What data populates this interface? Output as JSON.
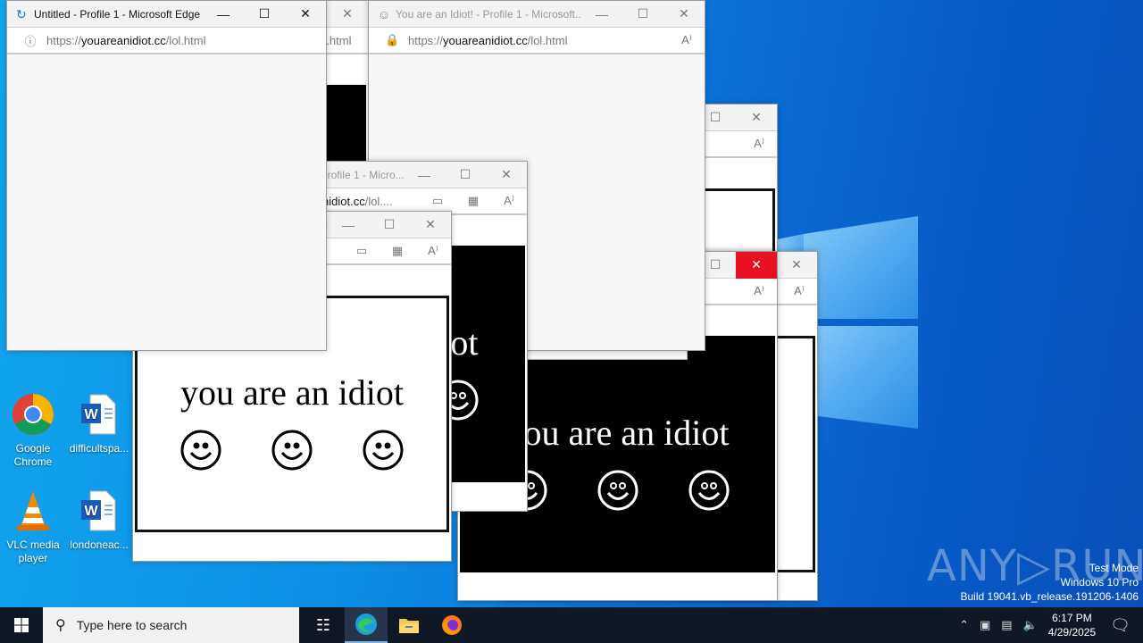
{
  "desktop": {
    "icons": [
      {
        "label": "Google Chrome",
        "icon": "chrome-icon"
      },
      {
        "label": "difficultspa...",
        "icon": "word-document-icon"
      },
      {
        "label": "VLC media player",
        "icon": "vlc-icon"
      },
      {
        "label": "londoneac...",
        "icon": "word-document-icon"
      }
    ]
  },
  "windows": [
    {
      "id": "c",
      "title": "You are an Idiot! - Profile 1 - Microsoft...",
      "url_pre": "https://",
      "url_host": "youareanidiot.cc",
      "url_path": "/lol.html",
      "tools": [
        "read-aloud"
      ],
      "content": "idiot",
      "inverted": false,
      "active": false,
      "red_close": false
    },
    {
      "id": "a",
      "title": "You are an Idiot! - Profile 1 - Microsoft...",
      "url_pre": "https://",
      "url_host": "youareanidiot.cc",
      "url_path": "/lol.html",
      "tools": [
        "read-aloud"
      ],
      "content": "idiot",
      "inverted": false,
      "active": false,
      "red_close": false
    },
    {
      "id": "b",
      "title": "You are an Idiot! - Profile 1 - Microsoft...",
      "url_pre": "https://",
      "url_host": "youareanidiot.cc",
      "url_path": "/lol.html",
      "tools": [
        "read-aloud"
      ],
      "content": "idiot",
      "inverted": true,
      "active": false,
      "red_close": true
    },
    {
      "id": "h",
      "title": "You are an Idiot! - Profile 1 - Microsoft...",
      "url_pre": "https://",
      "url_host": "youareanidiot.cc",
      "url_path": "/lol.html",
      "tools": [],
      "content": "idiot",
      "inverted": true,
      "active": false,
      "red_close": false
    },
    {
      "id": "d",
      "title": "You are an Idiot! - Profile 1 - Microsoft...",
      "url_pre": "https://",
      "url_host": "youareanidiot.cc",
      "url_path": "/lol.html",
      "lock": true,
      "tools": [
        "read-aloud"
      ],
      "content": "blank",
      "active": false,
      "red_close": false
    },
    {
      "id": "e",
      "title": "You are an Idiot! - Profile 1 - Micro...",
      "url_pre": "https://",
      "url_host": "youareanidiot.cc",
      "url_path": "/lol....",
      "tools": [
        "devices",
        "qr-code",
        "read-aloud"
      ],
      "content": "idiot",
      "inverted": true,
      "active": false,
      "red_close": false
    },
    {
      "id": "f",
      "title": "You are an Idiot! - Profile 1 - Micro...",
      "url_pre": "https://",
      "url_host": "youareanidiot.cc",
      "url_path": "/lol....",
      "tools": [
        "devices",
        "qr-code",
        "read-aloud"
      ],
      "content": "idiot",
      "inverted": false,
      "active": false,
      "red_close": false
    },
    {
      "id": "g",
      "title": "Untitled - Profile 1 - Microsoft Edge",
      "url_pre": "https://",
      "url_host": "youareanidiot.cc",
      "url_path": "/lol.html",
      "info": true,
      "loading": true,
      "tools": [],
      "content": "blank",
      "active": true,
      "red_close": false
    }
  ],
  "page_text": "you are an idiot",
  "taskbar": {
    "search_placeholder": "Type here to search",
    "apps": [
      "task-view",
      "edge",
      "file-explorer",
      "firefox"
    ],
    "time": "6:17 PM",
    "date": "4/29/2025"
  },
  "watermark": {
    "brand": "ANY RUN",
    "line1": "Test Mode",
    "line2": "Windows 10 Pro",
    "line3": "Build 19041.vb_release.191206-1406"
  },
  "colors": {
    "close_hover": "#e81123",
    "taskbar": "#101826"
  }
}
